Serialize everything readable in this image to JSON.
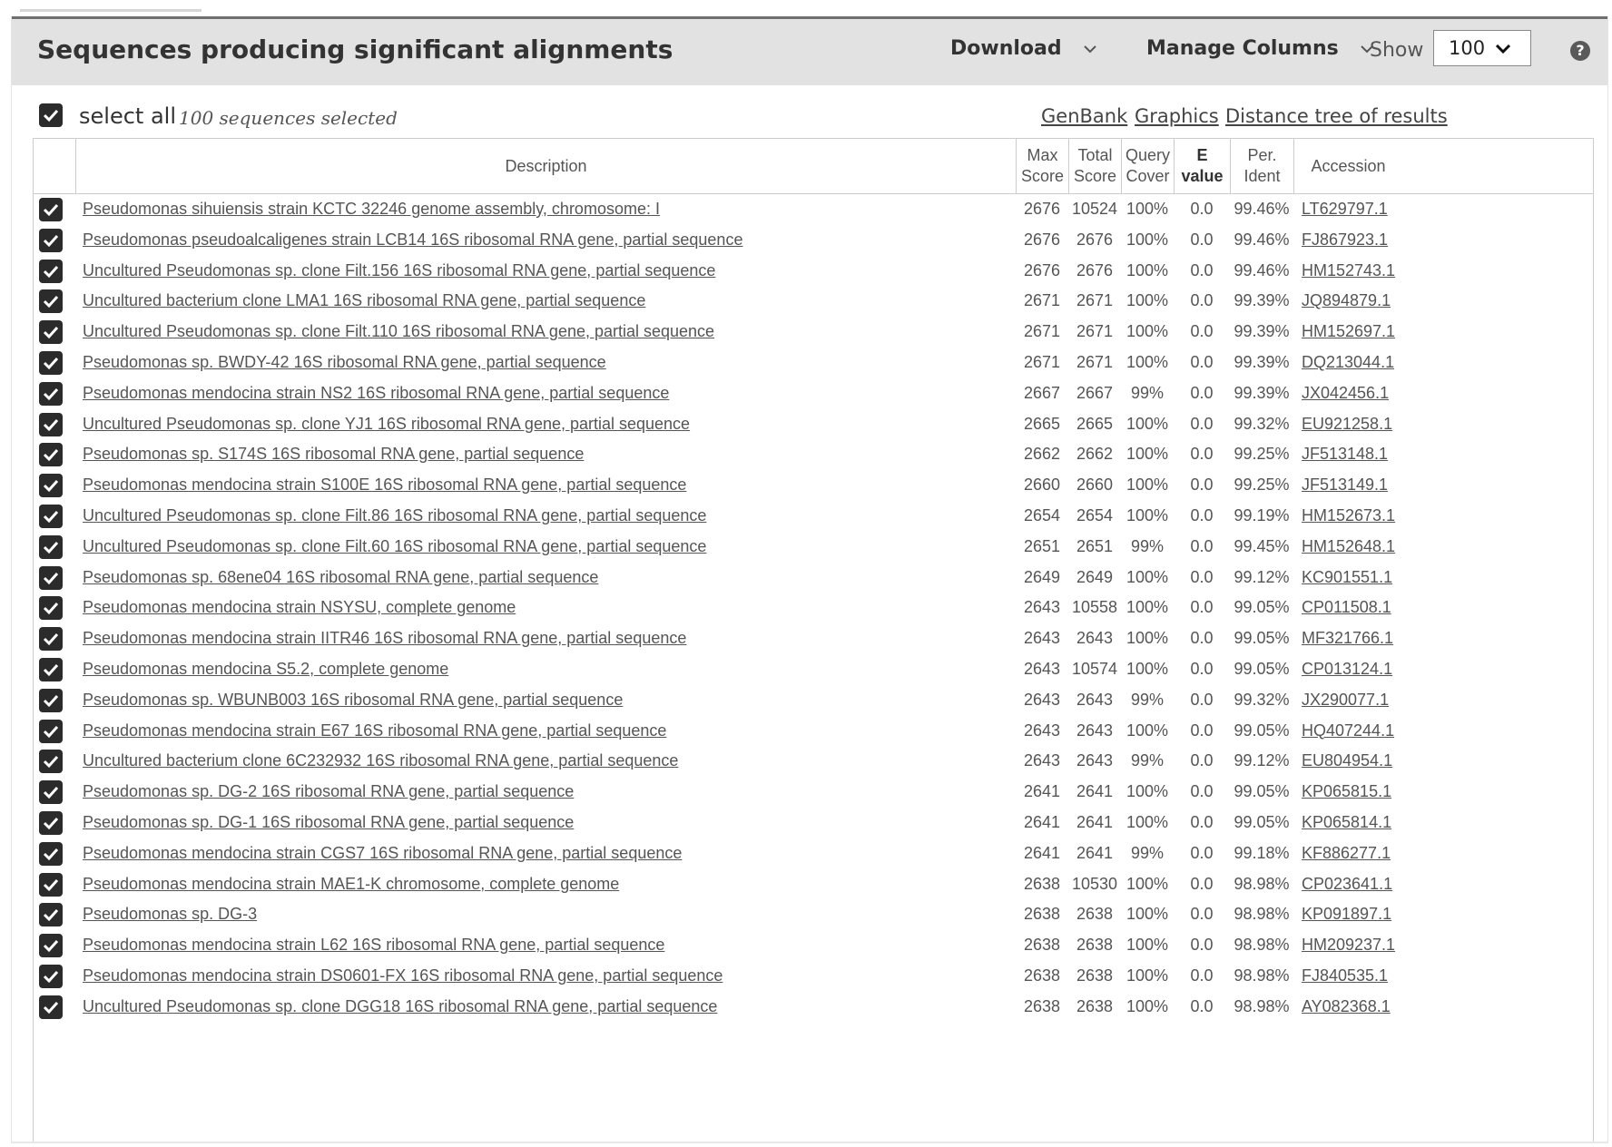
{
  "header": {
    "title": "Sequences producing significant alignments",
    "download_label": "Download",
    "manage_columns_label": "Manage Columns",
    "show_label": "Show",
    "show_value": "100"
  },
  "toolbar": {
    "select_all_label": "select all",
    "selected_count": "100 sequences selected",
    "links": [
      "GenBank",
      "Graphics",
      "Distance tree of results"
    ]
  },
  "columns": {
    "description": "Description",
    "max_score": [
      "Max",
      "Score"
    ],
    "total_score": [
      "Total",
      "Score"
    ],
    "query_cover": [
      "Query",
      "Cover"
    ],
    "e_value": [
      "E",
      "value"
    ],
    "per_ident": [
      "Per.",
      "Ident"
    ],
    "accession": "Accession"
  },
  "rows": [
    {
      "description": "Pseudomonas sihuiensis strain KCTC 32246 genome assembly, chromosome: I",
      "max_score": "2676",
      "total_score": "10524",
      "query_cover": "100%",
      "e_value": "0.0",
      "per_ident": "99.46%",
      "accession": "LT629797.1"
    },
    {
      "description": "Pseudomonas pseudoalcaligenes strain LCB14 16S ribosomal RNA gene, partial sequence",
      "max_score": "2676",
      "total_score": "2676",
      "query_cover": "100%",
      "e_value": "0.0",
      "per_ident": "99.46%",
      "accession": "FJ867923.1"
    },
    {
      "description": "Uncultured Pseudomonas sp. clone Filt.156 16S ribosomal RNA gene, partial sequence",
      "max_score": "2676",
      "total_score": "2676",
      "query_cover": "100%",
      "e_value": "0.0",
      "per_ident": "99.46%",
      "accession": "HM152743.1"
    },
    {
      "description": "Uncultured bacterium clone LMA1 16S ribosomal RNA gene, partial sequence",
      "max_score": "2671",
      "total_score": "2671",
      "query_cover": "100%",
      "e_value": "0.0",
      "per_ident": "99.39%",
      "accession": "JQ894879.1"
    },
    {
      "description": "Uncultured Pseudomonas sp. clone Filt.110 16S ribosomal RNA gene, partial sequence",
      "max_score": "2671",
      "total_score": "2671",
      "query_cover": "100%",
      "e_value": "0.0",
      "per_ident": "99.39%",
      "accession": "HM152697.1"
    },
    {
      "description": "Pseudomonas sp. BWDY-42 16S ribosomal RNA gene, partial sequence",
      "max_score": "2671",
      "total_score": "2671",
      "query_cover": "100%",
      "e_value": "0.0",
      "per_ident": "99.39%",
      "accession": "DQ213044.1"
    },
    {
      "description": "Pseudomonas mendocina strain NS2 16S ribosomal RNA gene, partial sequence",
      "max_score": "2667",
      "total_score": "2667",
      "query_cover": "99%",
      "e_value": "0.0",
      "per_ident": "99.39%",
      "accession": "JX042456.1"
    },
    {
      "description": "Uncultured Pseudomonas sp. clone YJ1 16S ribosomal RNA gene, partial sequence",
      "max_score": "2665",
      "total_score": "2665",
      "query_cover": "100%",
      "e_value": "0.0",
      "per_ident": "99.32%",
      "accession": "EU921258.1"
    },
    {
      "description": "Pseudomonas sp. S174S 16S ribosomal RNA gene, partial sequence",
      "max_score": "2662",
      "total_score": "2662",
      "query_cover": "100%",
      "e_value": "0.0",
      "per_ident": "99.25%",
      "accession": "JF513148.1"
    },
    {
      "description": "Pseudomonas mendocina strain S100E 16S ribosomal RNA gene, partial sequence",
      "max_score": "2660",
      "total_score": "2660",
      "query_cover": "100%",
      "e_value": "0.0",
      "per_ident": "99.25%",
      "accession": "JF513149.1"
    },
    {
      "description": "Uncultured Pseudomonas sp. clone Filt.86 16S ribosomal RNA gene, partial sequence",
      "max_score": "2654",
      "total_score": "2654",
      "query_cover": "100%",
      "e_value": "0.0",
      "per_ident": "99.19%",
      "accession": "HM152673.1"
    },
    {
      "description": "Uncultured Pseudomonas sp. clone Filt.60 16S ribosomal RNA gene, partial sequence",
      "max_score": "2651",
      "total_score": "2651",
      "query_cover": "99%",
      "e_value": "0.0",
      "per_ident": "99.45%",
      "accession": "HM152648.1"
    },
    {
      "description": "Pseudomonas sp. 68ene04 16S ribosomal RNA gene, partial sequence",
      "max_score": "2649",
      "total_score": "2649",
      "query_cover": "100%",
      "e_value": "0.0",
      "per_ident": "99.12%",
      "accession": "KC901551.1"
    },
    {
      "description": "Pseudomonas mendocina strain NSYSU, complete genome",
      "max_score": "2643",
      "total_score": "10558",
      "query_cover": "100%",
      "e_value": "0.0",
      "per_ident": "99.05%",
      "accession": "CP011508.1"
    },
    {
      "description": "Pseudomonas mendocina strain IITR46 16S ribosomal RNA gene, partial sequence",
      "max_score": "2643",
      "total_score": "2643",
      "query_cover": "100%",
      "e_value": "0.0",
      "per_ident": "99.05%",
      "accession": "MF321766.1"
    },
    {
      "description": "Pseudomonas mendocina S5.2, complete genome",
      "max_score": "2643",
      "total_score": "10574",
      "query_cover": "100%",
      "e_value": "0.0",
      "per_ident": "99.05%",
      "accession": "CP013124.1"
    },
    {
      "description": "Pseudomonas sp. WBUNB003 16S ribosomal RNA gene, partial sequence",
      "max_score": "2643",
      "total_score": "2643",
      "query_cover": "99%",
      "e_value": "0.0",
      "per_ident": "99.32%",
      "accession": "JX290077.1"
    },
    {
      "description": "Pseudomonas mendocina strain E67 16S ribosomal RNA gene, partial sequence",
      "max_score": "2643",
      "total_score": "2643",
      "query_cover": "100%",
      "e_value": "0.0",
      "per_ident": "99.05%",
      "accession": "HQ407244.1"
    },
    {
      "description": "Uncultured bacterium clone 6C232932 16S ribosomal RNA gene, partial sequence",
      "max_score": "2643",
      "total_score": "2643",
      "query_cover": "99%",
      "e_value": "0.0",
      "per_ident": "99.12%",
      "accession": "EU804954.1"
    },
    {
      "description": "Pseudomonas sp. DG-2 16S ribosomal RNA gene, partial sequence",
      "max_score": "2641",
      "total_score": "2641",
      "query_cover": "100%",
      "e_value": "0.0",
      "per_ident": "99.05%",
      "accession": "KP065815.1"
    },
    {
      "description": "Pseudomonas sp. DG-1 16S ribosomal RNA gene, partial sequence",
      "max_score": "2641",
      "total_score": "2641",
      "query_cover": "100%",
      "e_value": "0.0",
      "per_ident": "99.05%",
      "accession": "KP065814.1"
    },
    {
      "description": "Pseudomonas mendocina strain CGS7 16S ribosomal RNA gene, partial sequence",
      "max_score": "2641",
      "total_score": "2641",
      "query_cover": "99%",
      "e_value": "0.0",
      "per_ident": "99.18%",
      "accession": "KF886277.1"
    },
    {
      "description": "Pseudomonas mendocina strain MAE1-K chromosome, complete genome",
      "max_score": "2638",
      "total_score": "10530",
      "query_cover": "100%",
      "e_value": "0.0",
      "per_ident": "98.98%",
      "accession": "CP023641.1"
    },
    {
      "description": "Pseudomonas sp. DG-3",
      "max_score": "2638",
      "total_score": "2638",
      "query_cover": "100%",
      "e_value": "0.0",
      "per_ident": "98.98%",
      "accession": "KP091897.1"
    },
    {
      "description": "Pseudomonas mendocina strain L62 16S ribosomal RNA gene, partial sequence",
      "max_score": "2638",
      "total_score": "2638",
      "query_cover": "100%",
      "e_value": "0.0",
      "per_ident": "98.98%",
      "accession": "HM209237.1"
    },
    {
      "description": "Pseudomonas mendocina strain DS0601-FX 16S ribosomal RNA gene, partial sequence",
      "max_score": "2638",
      "total_score": "2638",
      "query_cover": "100%",
      "e_value": "0.0",
      "per_ident": "98.98%",
      "accession": "FJ840535.1"
    },
    {
      "description": "Uncultured Pseudomonas sp. clone DGG18 16S ribosomal RNA gene, partial sequence",
      "max_score": "2638",
      "total_score": "2638",
      "query_cover": "100%",
      "e_value": "0.0",
      "per_ident": "98.98%",
      "accession": "AY082368.1"
    }
  ],
  "icons": {
    "checkbox": "checkbox-checked-icon",
    "chevron": "chevron-down-icon",
    "help": "help-icon"
  },
  "colors": {
    "header_bg": "#e2e2e2",
    "checkbox": "#2b2b2b",
    "text": "#555555"
  }
}
